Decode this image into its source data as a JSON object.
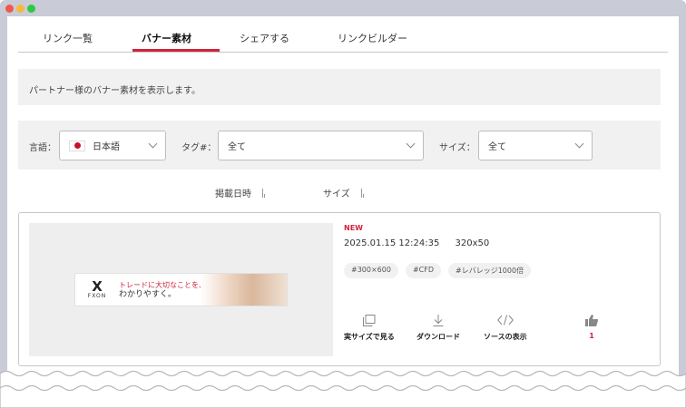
{
  "tabs": [
    {
      "label": "リンク一覧"
    },
    {
      "label": "バナー素材"
    },
    {
      "label": "シェアする"
    },
    {
      "label": "リンクビルダー"
    }
  ],
  "info": {
    "text": "パートナー様のバナー素材を表示します。"
  },
  "filters": {
    "language": {
      "label": "言語：",
      "value": "日本語"
    },
    "tag": {
      "label": "タグ#：",
      "value": "全て"
    },
    "size": {
      "label": "サイズ：",
      "value": "全て"
    }
  },
  "sort": {
    "date_label": "掲載日時",
    "size_label": "サイズ"
  },
  "card": {
    "badge": "NEW",
    "timestamp": "2025.01.15 12:24:35",
    "size": "320x50",
    "tags": [
      "#300×600",
      "#CFD",
      "#レバレッジ1000倍"
    ],
    "banner": {
      "brand": "FXON",
      "line1": "トレードに大切なことを、",
      "line2": "わかりやすく。"
    },
    "actions": {
      "view": "実サイズで見る",
      "download": "ダウンロード",
      "source": "ソースの表示",
      "likes": "1"
    }
  },
  "colors": {
    "accent": "#d0243b",
    "panel": "#f1f1f1"
  }
}
